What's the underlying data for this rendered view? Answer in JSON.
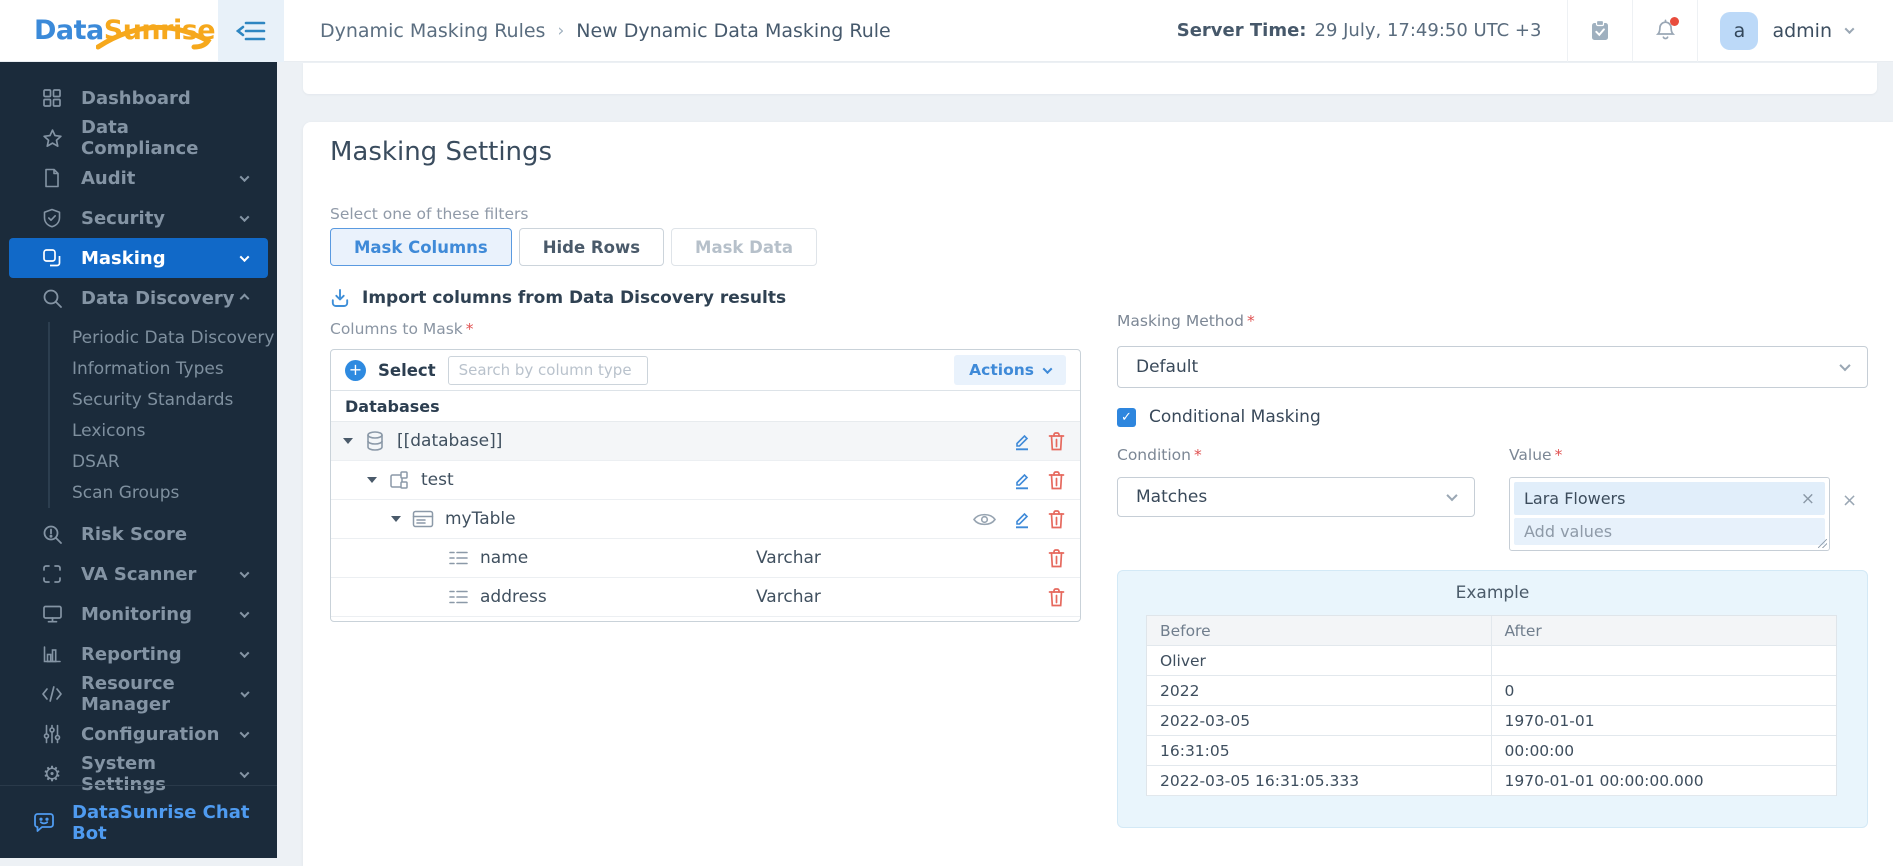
{
  "colors": {
    "brand_blue": "#3b8ad9",
    "brand_orange": "#f6a81c",
    "sidebar_bg": "#1b2b3b",
    "active_item_bg": "#1169c8",
    "accent_blue": "#3f8ad8",
    "danger_red": "#e6695e",
    "notification_dot": "#e84c3d",
    "example_panel_bg": "#e9f5fc"
  },
  "icons": {
    "plus": "+",
    "close": "×",
    "check": "✓",
    "gear": "⚙",
    "breadcrumb_sep": "›"
  },
  "navbar": {
    "logo_part1": "Data",
    "logo_part2": "Sunrise",
    "breadcrumb": [
      "Dynamic Masking Rules",
      "New Dynamic Data Masking Rule"
    ],
    "server_time_label": "Server Time:",
    "server_time_value": "29 July, 17:49:50 UTC +3",
    "user_initial": "a",
    "user_name": "admin"
  },
  "sidebar": {
    "items": [
      {
        "label": "Dashboard"
      },
      {
        "label": "Data Compliance"
      },
      {
        "label": "Audit"
      },
      {
        "label": "Security"
      },
      {
        "label": "Masking"
      },
      {
        "label": "Data Discovery"
      },
      {
        "label": "Risk Score"
      },
      {
        "label": "VA Scanner"
      },
      {
        "label": "Monitoring"
      },
      {
        "label": "Reporting"
      },
      {
        "label": "Resource Manager"
      },
      {
        "label": "Configuration"
      },
      {
        "label": "System Settings"
      }
    ],
    "discovery_children": [
      "Periodic Data Discovery",
      "Information Types",
      "Security Standards",
      "Lexicons",
      "DSAR",
      "Scan Groups"
    ],
    "chat_bot_label": "DataSunrise Chat Bot"
  },
  "main": {
    "title": "Masking Settings",
    "filters": {
      "label": "Select one of these filters",
      "mask_columns": "Mask Columns",
      "hide_rows": "Hide Rows",
      "mask_data": "Mask Data"
    },
    "import_link": "Import columns from Data Discovery results",
    "columns_to_mask": {
      "label": "Columns to Mask",
      "required": "*"
    },
    "selector": {
      "select_label": "Select",
      "search_placeholder": "Search by column type",
      "actions_label": "Actions",
      "group_header": "Databases"
    },
    "tree": {
      "nodes": [
        {
          "label": "[[database]]"
        },
        {
          "label": "test"
        },
        {
          "label": "myTable"
        },
        {
          "label": "name",
          "datatype": "Varchar"
        },
        {
          "label": "address",
          "datatype": "Varchar"
        }
      ]
    },
    "masking_method": {
      "label": "Masking Method",
      "required": "*",
      "value": "Default"
    },
    "conditional_masking_label": "Conditional Masking",
    "condition": {
      "label": "Condition",
      "required": "*",
      "value": "Matches"
    },
    "value_field": {
      "label": "Value",
      "required": "*",
      "tag": "Lara Flowers",
      "placeholder": "Add values"
    },
    "example": {
      "title": "Example",
      "headers": [
        "Before",
        "After"
      ],
      "rows": [
        [
          "Oliver",
          ""
        ],
        [
          "2022",
          "0"
        ],
        [
          "2022-03-05",
          "1970-01-01"
        ],
        [
          "16:31:05",
          "00:00:00"
        ],
        [
          "2022-03-05 16:31:05.333",
          "1970-01-01 00:00:00.000"
        ]
      ]
    }
  }
}
